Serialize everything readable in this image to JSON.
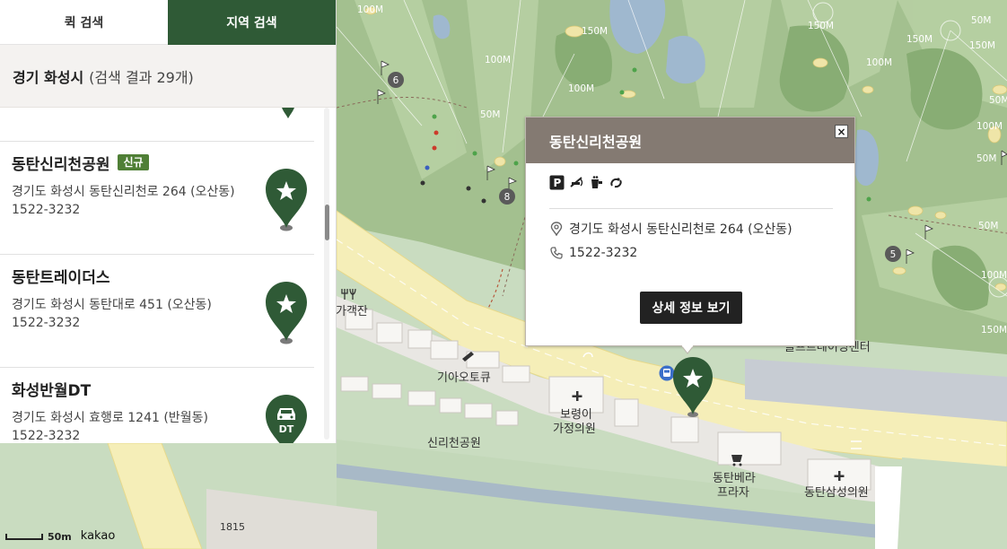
{
  "tabs": {
    "quick": "퀵 검색",
    "region": "지역 검색"
  },
  "result_header": {
    "region": "경기 화성시",
    "count": "(검색 결과 29개)"
  },
  "list": [
    {
      "title": "동탄신리천공원",
      "badge": "신규",
      "address": "경기도 화성시 동탄신리천로 264 (오산동)",
      "phone": "1522-3232",
      "pin": "star"
    },
    {
      "title": "동탄트레이더스",
      "badge": "",
      "address": "경기도 화성시 동탄대로 451 (오산동)",
      "phone": "1522-3232",
      "pin": "star"
    },
    {
      "title": "화성반월DT",
      "badge": "",
      "address": "경기도 화성시 효행로 1241 (반월동)",
      "phone": "1522-3232",
      "pin": "drive-thru",
      "pin_label": "DT"
    }
  ],
  "popup": {
    "title": "동탄신리천공원",
    "close": "×",
    "amenity_icons": [
      "parking-icon",
      "no-smoking-icon",
      "drink-icon",
      "recycle-icon"
    ],
    "parking_letter": "P",
    "address": "경기도 화성시 동탄신리천로 264 (오산동)",
    "phone": "1522-3232",
    "detail_button": "상세 정보 보기"
  },
  "map": {
    "labels": {
      "gagakjan": "가객잔",
      "kia_autoq": "기아오토큐",
      "boryeong_clinic_1": "보령이",
      "boryeong_clinic_2": "가정의원",
      "sinricheon_park": "신리천공원",
      "dongtan_bella_1": "동탄베라",
      "dongtan_bella_2": "프라자",
      "dongtan_samsung": "동탄삼성의원",
      "center_partial": "골프트레이닝센터",
      "num_1815": "1815"
    },
    "distance_labels": [
      "100M",
      "150M",
      "150M",
      "100M",
      "50M",
      "50M",
      "100M",
      "150M",
      "100M",
      "50M",
      "150M",
      "100M",
      "50M",
      "50M",
      "100M",
      "150M"
    ],
    "hole_numbers": [
      "6",
      "8",
      "5"
    ],
    "colors": {
      "panel_accent": "#2f5a36",
      "pin": "#2f5a36",
      "popup_header": "#847a72",
      "road": "#f5eeb8",
      "golf": "#88ad74"
    }
  },
  "scale": {
    "value": "50m",
    "brand": "kakao"
  }
}
